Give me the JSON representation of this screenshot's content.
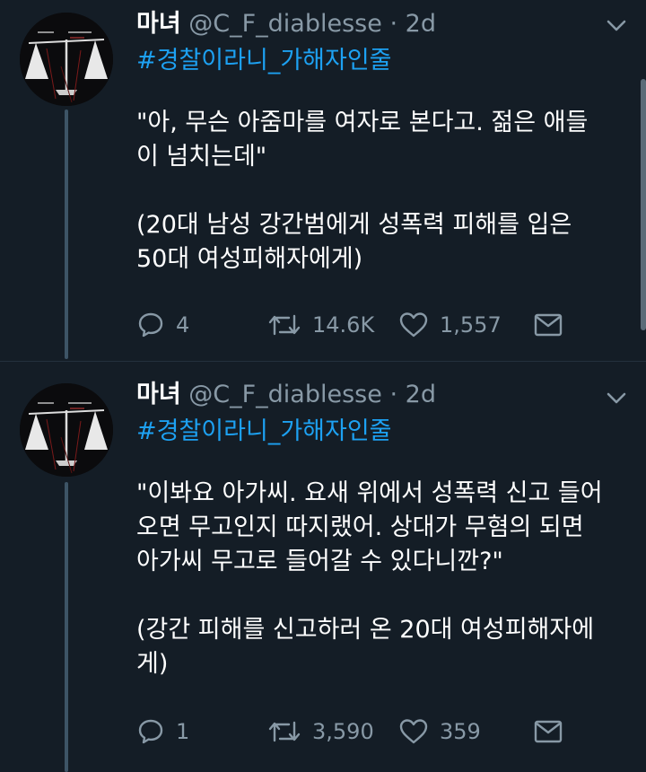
{
  "colors": {
    "background": "#141d26",
    "link": "#1da1f2",
    "muted": "#8899a6",
    "text": "#ffffff"
  },
  "tweets": [
    {
      "name": "마녀",
      "handle": "@C_F_diablesse",
      "separator": "·",
      "time": "2d",
      "hashtag": "#경찰이라니_가해자인줄",
      "lines_a": [
        "\"아, 무슨 아줌마를 여자로 본다고. 젊은 애들",
        "이 넘치는데\""
      ],
      "lines_b": [
        "(20대 남성 강간범에게 성폭력 피해를 입은",
        "50대 여성피해자에게)"
      ],
      "replies": "4",
      "retweets": "14.6K",
      "likes": "1,557"
    },
    {
      "name": "마녀",
      "handle": "@C_F_diablesse",
      "separator": "·",
      "time": "2d",
      "hashtag": "#경찰이라니_가해자인줄",
      "lines_a": [
        "\"이봐요 아가씨. 요새 위에서 성폭력 신고 들어",
        "오면 무고인지 따지랬어. 상대가 무혐의 되면",
        "아가씨 무고로 들어갈 수 있다니깐?\""
      ],
      "lines_b": [
        "(강간 피해를 신고하러 온 20대 여성피해자에",
        "게)"
      ],
      "replies": "1",
      "retweets": "3,590",
      "likes": "359"
    }
  ],
  "icons": {
    "reply": "reply-icon",
    "retweet": "retweet-icon",
    "like": "heart-icon",
    "dm": "envelope-icon",
    "caret": "chevron-down-icon"
  }
}
